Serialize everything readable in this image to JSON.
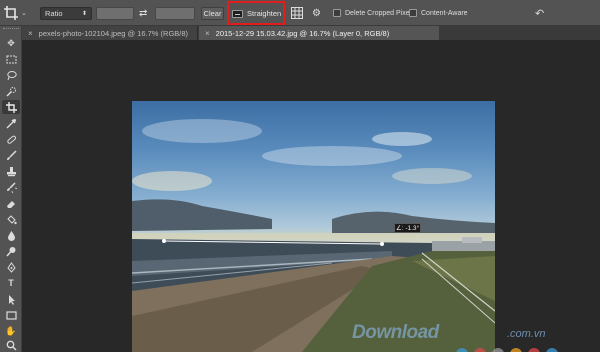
{
  "options_bar": {
    "tool_preset_icon": "crop-icon",
    "ratio_label": "Ratio",
    "width_value": "",
    "height_value": "",
    "swap_icon": "swap-arrows-icon",
    "clear_label": "Clear",
    "straighten_label": "Straighten",
    "straighten_icon": "level-icon",
    "overlay_icon": "grid-overlay-icon",
    "settings_icon": "gear-icon",
    "delete_cropped_label": "Delete Cropped Pixels",
    "content_aware_label": "Content-Aware",
    "reset_icon": "reset-icon",
    "highlight_color": "#e01e1e"
  },
  "tabs": [
    {
      "label": "pexels-photo-102104.jpeg @ 16.7% (RGB/8)",
      "close": "×"
    },
    {
      "label": "2015-12-29 15.03.42.jpg @ 16.7% (Layer 0, RGB/8)",
      "close": "×"
    }
  ],
  "tools": [
    "move-icon",
    "marquee-icon",
    "lasso-icon",
    "quick-select-icon",
    "crop-icon",
    "eyedropper-icon",
    "healing-brush-icon",
    "brush-icon",
    "clone-stamp-icon",
    "history-brush-icon",
    "eraser-icon",
    "paint-bucket-icon",
    "blur-icon",
    "dodge-icon",
    "pen-icon",
    "type-icon",
    "path-select-icon",
    "rectangle-icon",
    "hand-icon",
    "zoom-icon"
  ],
  "canvas": {
    "angle_readout": "∠: -1.3°",
    "watermark_text": "Download",
    "watermark_suffix": ".com.vn",
    "dot_colors": [
      "#3a9ad9",
      "#e04848",
      "#9a9a9a",
      "#f0a020",
      "#e04848",
      "#3a9ad9"
    ]
  }
}
